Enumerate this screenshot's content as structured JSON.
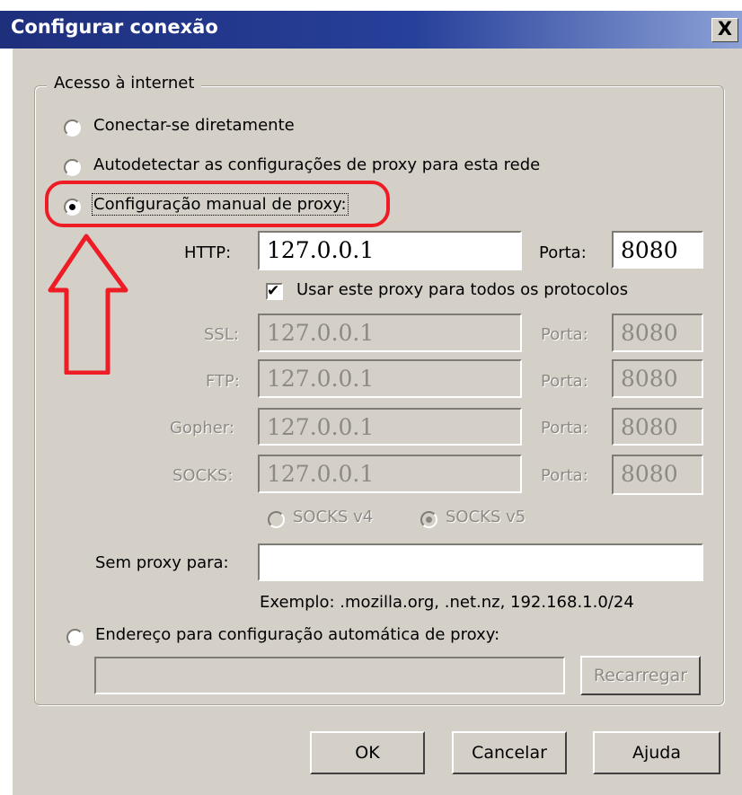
{
  "dialog": {
    "title": "Configurar conexão",
    "close_glyph": "X"
  },
  "group": {
    "legend": "Acesso à internet"
  },
  "options": {
    "direct": "Conectar-se diretamente",
    "autodetect": "Autodetectar as configurações de proxy para esta rede",
    "manual": "Configuração manual de proxy:",
    "autoconfig_url": "Endereço para configuração automática de proxy:"
  },
  "manual_proxy": {
    "http": {
      "label": "HTTP:",
      "value": "127.0.0.1",
      "port_label": "Porta:",
      "port": "8080"
    },
    "use_for_all": {
      "label": "Usar este proxy para todos os protocolos",
      "checked": true
    },
    "ssl": {
      "label": "SSL:",
      "value": "127.0.0.1",
      "port_label": "Porta:",
      "port": "8080"
    },
    "ftp": {
      "label": "FTP:",
      "value": "127.0.0.1",
      "port_label": "Porta:",
      "port": "8080"
    },
    "gopher": {
      "label": "Gopher:",
      "value": "127.0.0.1",
      "port_label": "Porta:",
      "port": "8080"
    },
    "socks": {
      "label": "SOCKS:",
      "value": "127.0.0.1",
      "port_label": "Porta:",
      "port": "8080"
    },
    "socks_v4": "SOCKS v4",
    "socks_v5": "SOCKS v5",
    "no_proxy_label": "Sem proxy para:",
    "no_proxy_value": "",
    "example": "Exemplo: .mozilla.org, .net.nz, 192.168.1.0/24"
  },
  "autoconfig": {
    "url_value": "",
    "reload_label": "Recarregar"
  },
  "buttons": {
    "ok": "OK",
    "cancel": "Cancelar",
    "help": "Ajuda"
  },
  "selected_option": "manual",
  "annotation_color": "#ee1c24"
}
